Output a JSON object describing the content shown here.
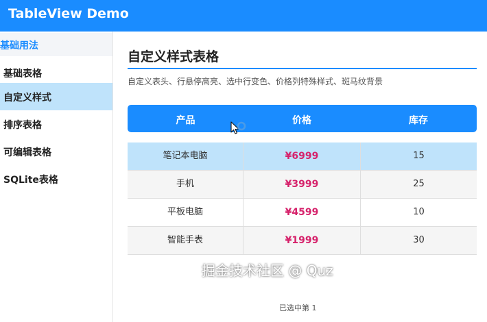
{
  "app": {
    "title": "TableView Demo"
  },
  "sidebar": {
    "section": "基础用法",
    "items": [
      {
        "label": "基础表格"
      },
      {
        "label": "自定义样式"
      },
      {
        "label": "排序表格"
      },
      {
        "label": "可编辑表格"
      },
      {
        "label": "SQLite表格"
      }
    ],
    "active_index": 1
  },
  "main": {
    "title": "自定义样式表格",
    "description": "自定义表头、行悬停高亮、选中行变色、价格列特殊样式、斑马纹背景",
    "table": {
      "columns": [
        "产品",
        "价格",
        "库存"
      ],
      "rows": [
        {
          "product": "笔记本电脑",
          "price": "¥6999",
          "stock": "15"
        },
        {
          "product": "手机",
          "price": "¥3999",
          "stock": "25"
        },
        {
          "product": "平板电脑",
          "price": "¥4599",
          "stock": "10"
        },
        {
          "product": "智能手表",
          "price": "¥1999",
          "stock": "30"
        }
      ],
      "selected_row": 0
    },
    "status": "已选中第 1"
  },
  "watermark": "掘金技术社区 @ Quz",
  "colors": {
    "accent": "#1a8cff",
    "selected": "#bfe3fb",
    "price": "#d6226b"
  },
  "icons": {
    "cursor": "mouse-pointer-icon",
    "busy": "loading-ring-icon"
  }
}
